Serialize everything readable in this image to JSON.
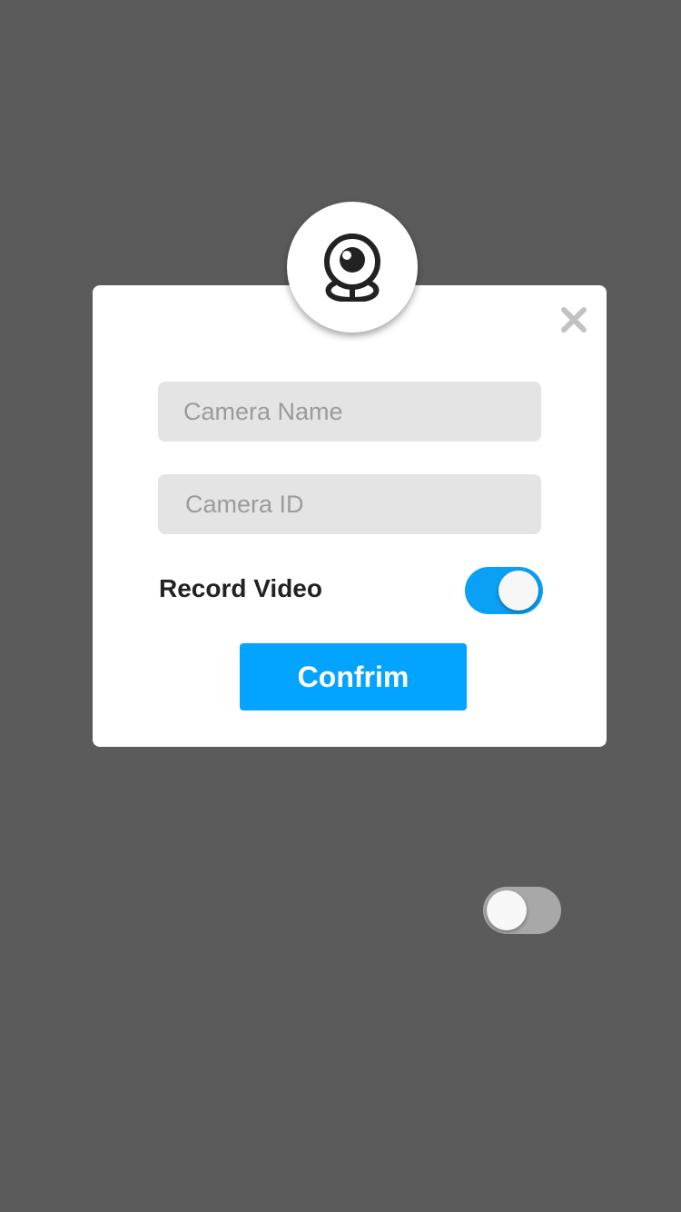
{
  "dialog": {
    "camera_name_placeholder": "Camera Name",
    "camera_id_placeholder": "Camera ID",
    "record_video_label": "Record Video",
    "record_video_on": true,
    "confirm_label": "Confrim"
  },
  "background_toggle": {
    "on": false
  },
  "colors": {
    "overlay": "#5b5b5b",
    "accent": "#03a4ff",
    "toggle_on": "#0aa0f5",
    "toggle_off": "#a8a8a8",
    "input_bg": "#e4e4e4"
  },
  "icons": {
    "badge": "webcam-icon",
    "close": "close-icon"
  }
}
